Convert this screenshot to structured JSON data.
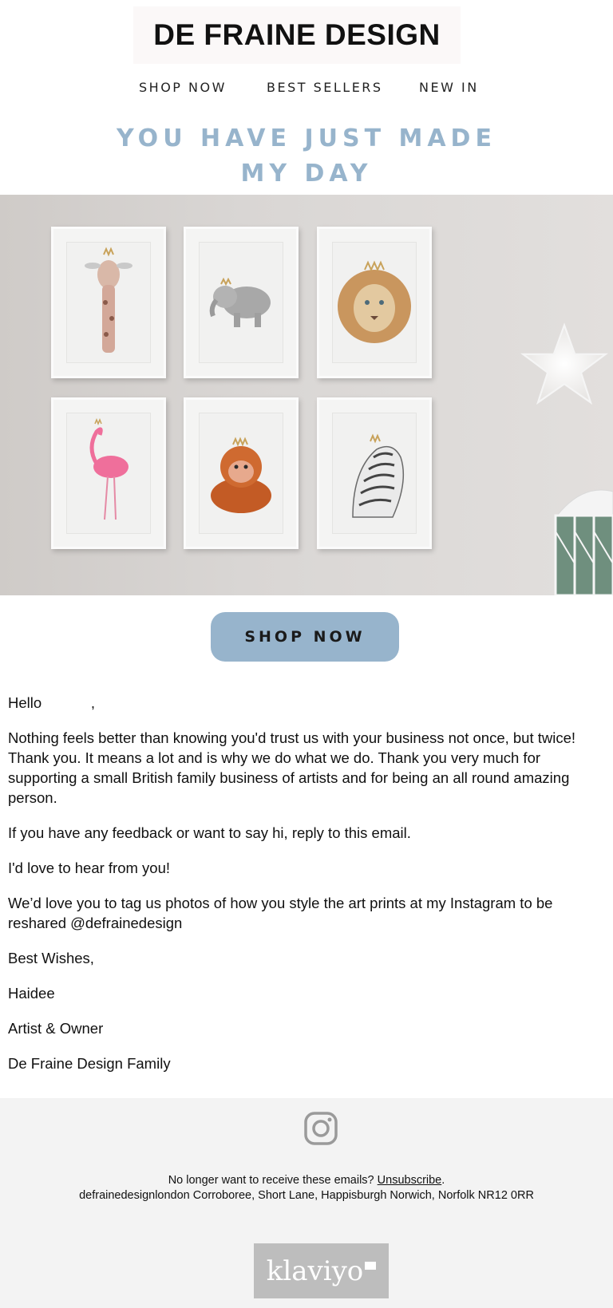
{
  "header": {
    "logo_text": "DE FRAINE DESIGN"
  },
  "nav": {
    "items": [
      "SHOP NOW",
      "BEST SELLERS",
      "NEW IN"
    ]
  },
  "headline": {
    "line1": "YOU HAVE JUST MADE",
    "line2": "MY DAY"
  },
  "hero": {
    "frames": [
      "giraffe",
      "elephant",
      "lion",
      "flamingo",
      "orangutan",
      "zebra"
    ]
  },
  "cta": {
    "label": "SHOP NOW"
  },
  "message": {
    "greeting": "Hello            ,",
    "p1": "Nothing feels better than knowing you'd trust us with your business not once, but twice! Thank you. It means a lot and is why we do what we do. Thank you very much for supporting a small British family business of artists and for being an all round amazing person.",
    "p2": "If you have any feedback or want to say hi, reply to this email.",
    "p3": "I'd love to hear from you!",
    "p4": "We’d love you to tag us photos of how you style the art prints at my Instagram to be reshared @defrainedesign",
    "signoff": "Best Wishes,",
    "name": "Haidee",
    "role": "Artist & Owner",
    "family": "De Fraine Design Family"
  },
  "footer": {
    "unsub_prefix": "No longer want to receive these emails? ",
    "unsub_link": "Unsubscribe",
    "unsub_suffix": ".",
    "address": "defrainedesignlondon Corroboree, Short Lane, Happisburgh Norwich, Norfolk NR12 0RR",
    "badge": "klaviyo"
  },
  "colors": {
    "accent": "#97b4cc",
    "footer_bg": "#f3f3f3",
    "badge_bg": "#bdbdbd"
  },
  "icons": {
    "social": "instagram-icon",
    "star": "star-lamp-icon"
  }
}
